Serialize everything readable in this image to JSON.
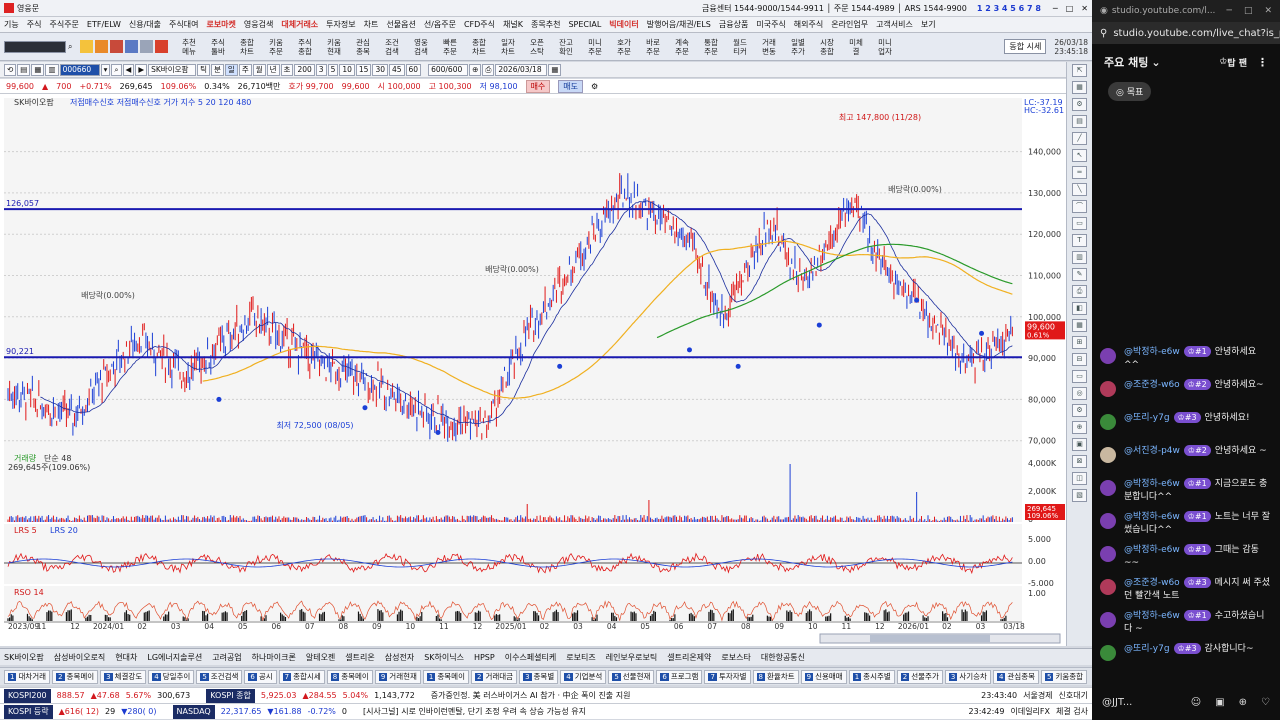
{
  "app": {
    "title": "영웅문",
    "menu_items": [
      "기능",
      "주식",
      "주식주문",
      "ETF/ELW",
      "신용/대출",
      "주식대여",
      "로보마켓",
      "영웅검색",
      "대체거래소",
      "투자정보",
      "차트",
      "선물옵션",
      "선/옵주문",
      "CFD주식",
      "채널K",
      "종목추천",
      "SPECIAL",
      "빅데이터",
      "발행어음/채권/ELS",
      "금융상품",
      "미국주식",
      "해외주식",
      "온라인업무",
      "고객서비스",
      "보기"
    ],
    "menu_highlighted": [
      "로보마켓",
      "대체거래소",
      "빅데이터"
    ],
    "call_center": "금융센터 1544-9000/1544-9911 │ 주문 1544-4989 │ ARS 1544-9900",
    "date": "26/03/18",
    "time": "23:45:18",
    "time_hm": "23:45:18",
    "window_numbers": [
      "1",
      "2",
      "3",
      "4",
      "5",
      "6",
      "7",
      "8"
    ],
    "toolbar_buttons": [
      [
        "추천",
        "메뉴"
      ],
      [
        "주식",
        "툴바"
      ],
      [
        "종합",
        "차트"
      ],
      [
        "키움",
        "주문"
      ],
      [
        "주식",
        "종합"
      ],
      [
        "키움",
        "현재"
      ],
      [
        "관심",
        "종목"
      ],
      [
        "조건",
        "검색"
      ],
      [
        "영웅",
        "검색"
      ],
      [
        "빠른",
        "주문"
      ],
      [
        "종합",
        "차트"
      ],
      [
        "일자",
        "차트"
      ],
      [
        "오픈",
        "스탁"
      ],
      [
        "잔고",
        "확인"
      ],
      [
        "미니",
        "주문"
      ],
      [
        "호가",
        "주문"
      ],
      [
        "바로",
        "주문"
      ],
      [
        "계속",
        "주문"
      ],
      [
        "통합",
        "주문"
      ],
      [
        "월드",
        "티커"
      ],
      [
        "거래",
        "변동"
      ],
      [
        "일별",
        "주가"
      ],
      [
        "시장",
        "종합"
      ],
      [
        "미체",
        "결"
      ],
      [
        "미니",
        "업자"
      ]
    ],
    "right_label": "동합 시세"
  },
  "chart_ctrl": {
    "code": "000660",
    "name": "SK바이오팜",
    "periods": [
      "200",
      "3",
      "5",
      "10",
      "15",
      "30",
      "45",
      "60"
    ],
    "count": "600/600",
    "date": "2026/03/18"
  },
  "quote": {
    "price": "99,600",
    "change": "700",
    "pct": "+0.71%",
    "volume": "269,645",
    "ratio": "109.06%",
    "ratio2": "0.34%",
    "amount": "26,710백만",
    "ask": "호가 99,700",
    "bid": "99,600",
    "open": "시 100,000",
    "high": "고 100,300",
    "low": "저 98,100",
    "buy": "매수",
    "sell": "매도"
  },
  "chart_data": {
    "type": "candlestick",
    "title": "SK바이오팜",
    "indicator_legend": "저점매수신호  저점매수신호  거가 지수 5 20 120 480",
    "hlines": [
      {
        "value": 126.057,
        "label": "126,057"
      },
      {
        "value": 90.221,
        "label": "90,221"
      }
    ],
    "annotations": [
      {
        "text": "최고 147,800 (11/28)"
      },
      {
        "text": "최저 72,500 (08/05)"
      },
      {
        "text": "배당락(0.00%)"
      },
      {
        "text": "배당락(0.00%)"
      },
      {
        "text": "배당락(0.00%)"
      }
    ],
    "y_ticks": [
      "140,000",
      "130,000",
      "120,000",
      "110,000",
      "100,000",
      "90,000",
      "80,000",
      "70,000"
    ],
    "ylim": [
      68000,
      152000
    ],
    "x_ticks": [
      "2023/09",
      "11",
      "12",
      "2024/01",
      "02",
      "03",
      "04",
      "05",
      "06",
      "07",
      "08",
      "09",
      "10",
      "11",
      "12",
      "2025/01",
      "02",
      "03",
      "04",
      "05",
      "06",
      "07",
      "08",
      "09",
      "10",
      "11",
      "12",
      "2026/01",
      "02",
      "03",
      "03/18"
    ],
    "last_price_label": "99,600",
    "last_pct_label": "0.61%",
    "lc_label": "LC:-37.19",
    "hc_label": "HC:-32.61",
    "volume": {
      "title": "거래량",
      "sub": "단순 48",
      "note": "269,645주(109.06%)",
      "y_ticks": [
        "4,000K",
        "2,000K",
        "0"
      ],
      "last": "269,645",
      "last2": "109.06%"
    },
    "lrs": {
      "title": "LRS 5",
      "sub": "LRS 20",
      "y_ticks": [
        "5.000",
        "0.00",
        "-5.000"
      ]
    },
    "rsi": {
      "title": "RSO 14",
      "y_ticks": [
        "1.00"
      ]
    }
  },
  "stock_tabs": [
    "SK바이오팜",
    "삼성바이오로직",
    "현대차",
    "LG에너지솔루션",
    "고려공업",
    "하나마이크론",
    "알테오젠",
    "셀트리온",
    "삼성전자",
    "SK하이닉스",
    "HPSP",
    "이수스페셜티케",
    "로보티즈",
    "레인보우로보틱",
    "셀트리온제약",
    "로보스타",
    "대한항공통신"
  ],
  "window_tabs": [
    "대차거래",
    "종목메이",
    "체결강도",
    "당일추이",
    "조건검색",
    "공시",
    "종합시세",
    "종목메이",
    "거래현재",
    "종목메이",
    "거래대금",
    "종목별",
    "기업분석",
    "선물현재",
    "프로그램",
    "투자자별",
    "환율차트",
    "신용매매",
    "종시주별",
    "선물주가",
    "사기승차",
    "관심종목",
    "키움종합"
  ],
  "index1": {
    "label": "KOSPI200",
    "value": "888.57",
    "change": "▲47.68",
    "pct": "5.67%",
    "vol": "300,673",
    "label2": "KOSPI 종합",
    "value2": "5,925.03",
    "change2": "▲284.55",
    "pct2": "5.04%",
    "vol2": "1,143,772",
    "news": "증가중인정. 美 러스바이거스 AI 참가 · 中企 폭이 진출 지원",
    "time": "23:43:40",
    "tag": "서울경제",
    "btn": "신호대기"
  },
  "index2": {
    "label": "KOSPI 등락",
    "value": "▲616( 12)",
    "n": "29",
    "change": "▼280( 0)",
    "label2": "NASDAQ",
    "value2": "22,317.65",
    "change2": "▼161.88",
    "pct2": "-0.72%",
    "vol2": "0",
    "news": "[시사그널] 시로 인바이런멘탈, 단기 조정 우려 속 상승 가능성 유지",
    "time": "23:42:49",
    "tag": "이데일리FX",
    "btn": "체결 검사"
  },
  "browser": {
    "tab_title": "studio.youtube.com/l...",
    "url": "studio.youtube.com/live_chat?is_p...",
    "chat_title": "주요 채팅",
    "button_label": "목표",
    "sort_label": "탑 팬",
    "messages": [
      {
        "author": "@박정하-e6w",
        "badge": "#1",
        "text": "안녕하세요 ^^"
      },
      {
        "author": "@조준경-w6o",
        "badge": "#2",
        "text": "안녕하세요~"
      },
      {
        "author": "@또리-y7g",
        "badge": "#3",
        "text": "안녕하세요!"
      },
      {
        "author": "@서진경-p4w",
        "badge": "#2",
        "text": "안녕하세요 ~"
      },
      {
        "author": "@박정하-e6w",
        "badge": "#1",
        "text": "지금으로도 충분합니다^^"
      },
      {
        "author": "@박정하-e6w",
        "badge": "#1",
        "text": "노트는 너무 잘 썼습니다^^"
      },
      {
        "author": "@박정하-e6w",
        "badge": "#1",
        "text": "그때는 감동~~"
      },
      {
        "author": "@조준경-w6o",
        "badge": "#3",
        "text": "메시지 써 주셨던 빨간색 노트"
      },
      {
        "author": "@박정하-e6w",
        "badge": "#1",
        "text": "수고하셨습니다 ~"
      },
      {
        "author": "@또리-y7g",
        "badge": "#3",
        "text": "감사합니다~"
      }
    ],
    "input_user": "@JJT..."
  }
}
